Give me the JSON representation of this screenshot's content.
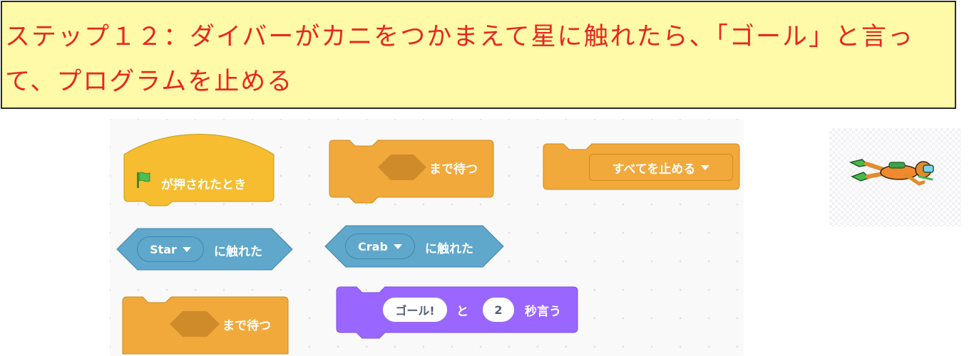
{
  "banner": {
    "line1": "ステップ１２：ダイバーがカニをつかまえて星に触れたら、「ゴール」と言っ",
    "line2": "て、プログラムを止める"
  },
  "blocks": {
    "flag_hat": {
      "label": "が押されたとき",
      "icon": "green-flag-icon"
    },
    "wait_until_1": {
      "label": "まで待つ"
    },
    "stop": {
      "option": "すべてを止める"
    },
    "touching_star": {
      "option": "Star",
      "label": "に触れた"
    },
    "touching_crab": {
      "option": "Crab",
      "label": "に触れた"
    },
    "wait_until_2": {
      "label": "まで待つ"
    },
    "say_for_secs": {
      "message": "ゴール!",
      "connector": "と",
      "secs": "2",
      "label": "秒言う"
    }
  },
  "sprite": {
    "icon": "diver-sprite-icon"
  },
  "colors": {
    "banner_bg": "#fffaa8",
    "banner_text": "#e8271f",
    "control": "#f2a93c",
    "events": "#f5bd2f",
    "sensing": "#5fa7cb",
    "looks": "#9966ff"
  }
}
